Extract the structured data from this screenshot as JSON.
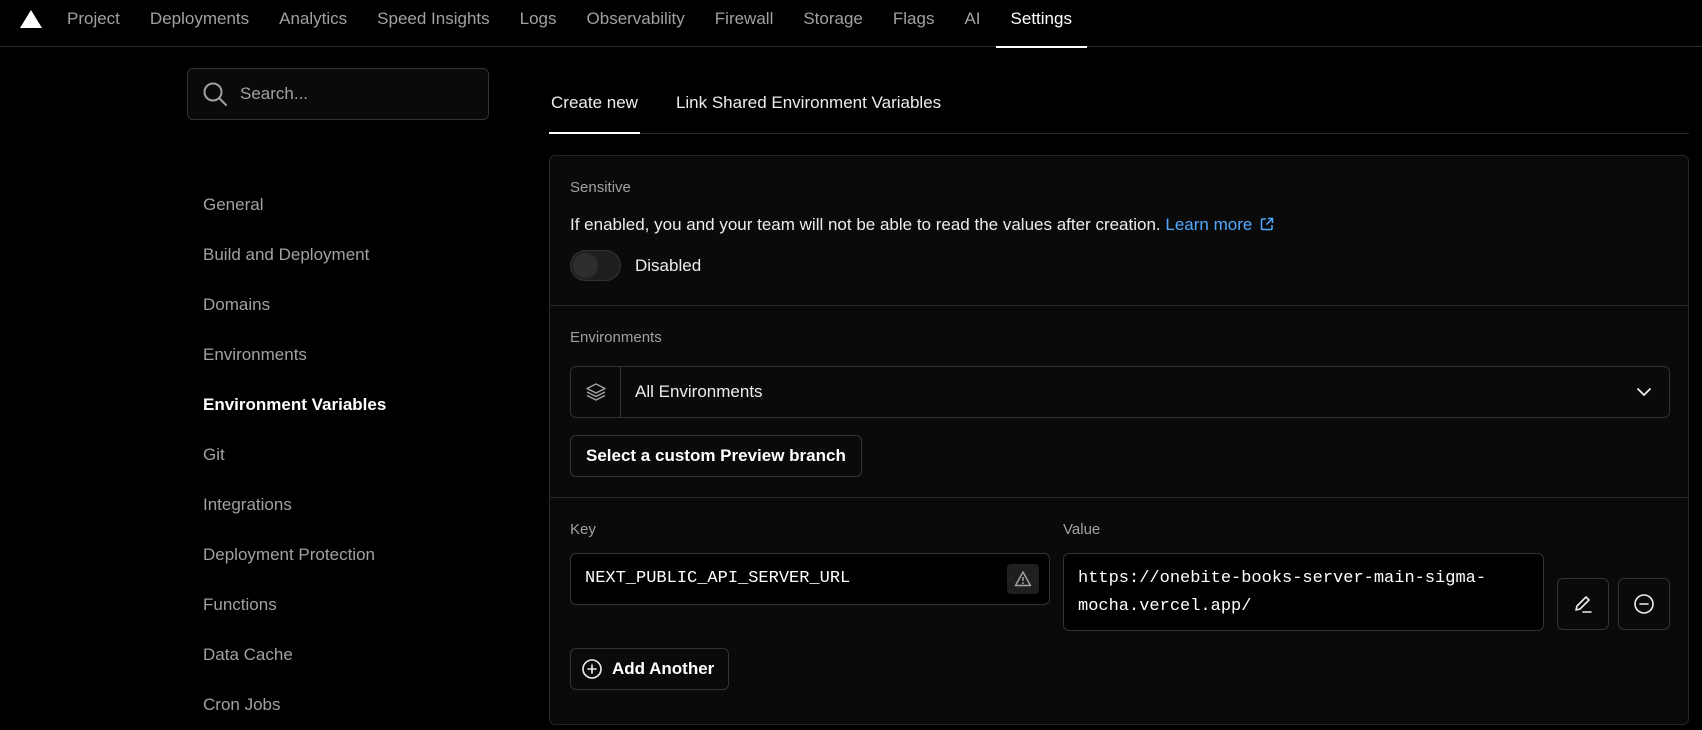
{
  "topnav": {
    "tabs": [
      "Project",
      "Deployments",
      "Analytics",
      "Speed Insights",
      "Logs",
      "Observability",
      "Firewall",
      "Storage",
      "Flags",
      "AI",
      "Settings"
    ],
    "active_tab": "Settings"
  },
  "sidebar": {
    "search_placeholder": "Search...",
    "items": [
      {
        "label": "General"
      },
      {
        "label": "Build and Deployment"
      },
      {
        "label": "Domains"
      },
      {
        "label": "Environments"
      },
      {
        "label": "Environment Variables",
        "active": true
      },
      {
        "label": "Git"
      },
      {
        "label": "Integrations"
      },
      {
        "label": "Deployment Protection"
      },
      {
        "label": "Functions"
      },
      {
        "label": "Data Cache"
      },
      {
        "label": "Cron Jobs"
      }
    ]
  },
  "subtabs": {
    "create_new": "Create new",
    "link_shared": "Link Shared Environment Variables"
  },
  "sensitive": {
    "label": "Sensitive",
    "description": "If enabled, you and your team will not be able to read the values after creation.",
    "learn_more": "Learn more",
    "toggle_state": "Disabled"
  },
  "environments": {
    "label": "Environments",
    "selected": "All Environments",
    "custom_branch_button": "Select a custom Preview branch"
  },
  "variable": {
    "key_label": "Key",
    "value_label": "Value",
    "key": "NEXT_PUBLIC_API_SERVER_URL",
    "value_line1": "https://onebite-books-server-main-sigma-",
    "value_line2": "mocha.vercel.app/"
  },
  "add_another": "Add Another"
}
